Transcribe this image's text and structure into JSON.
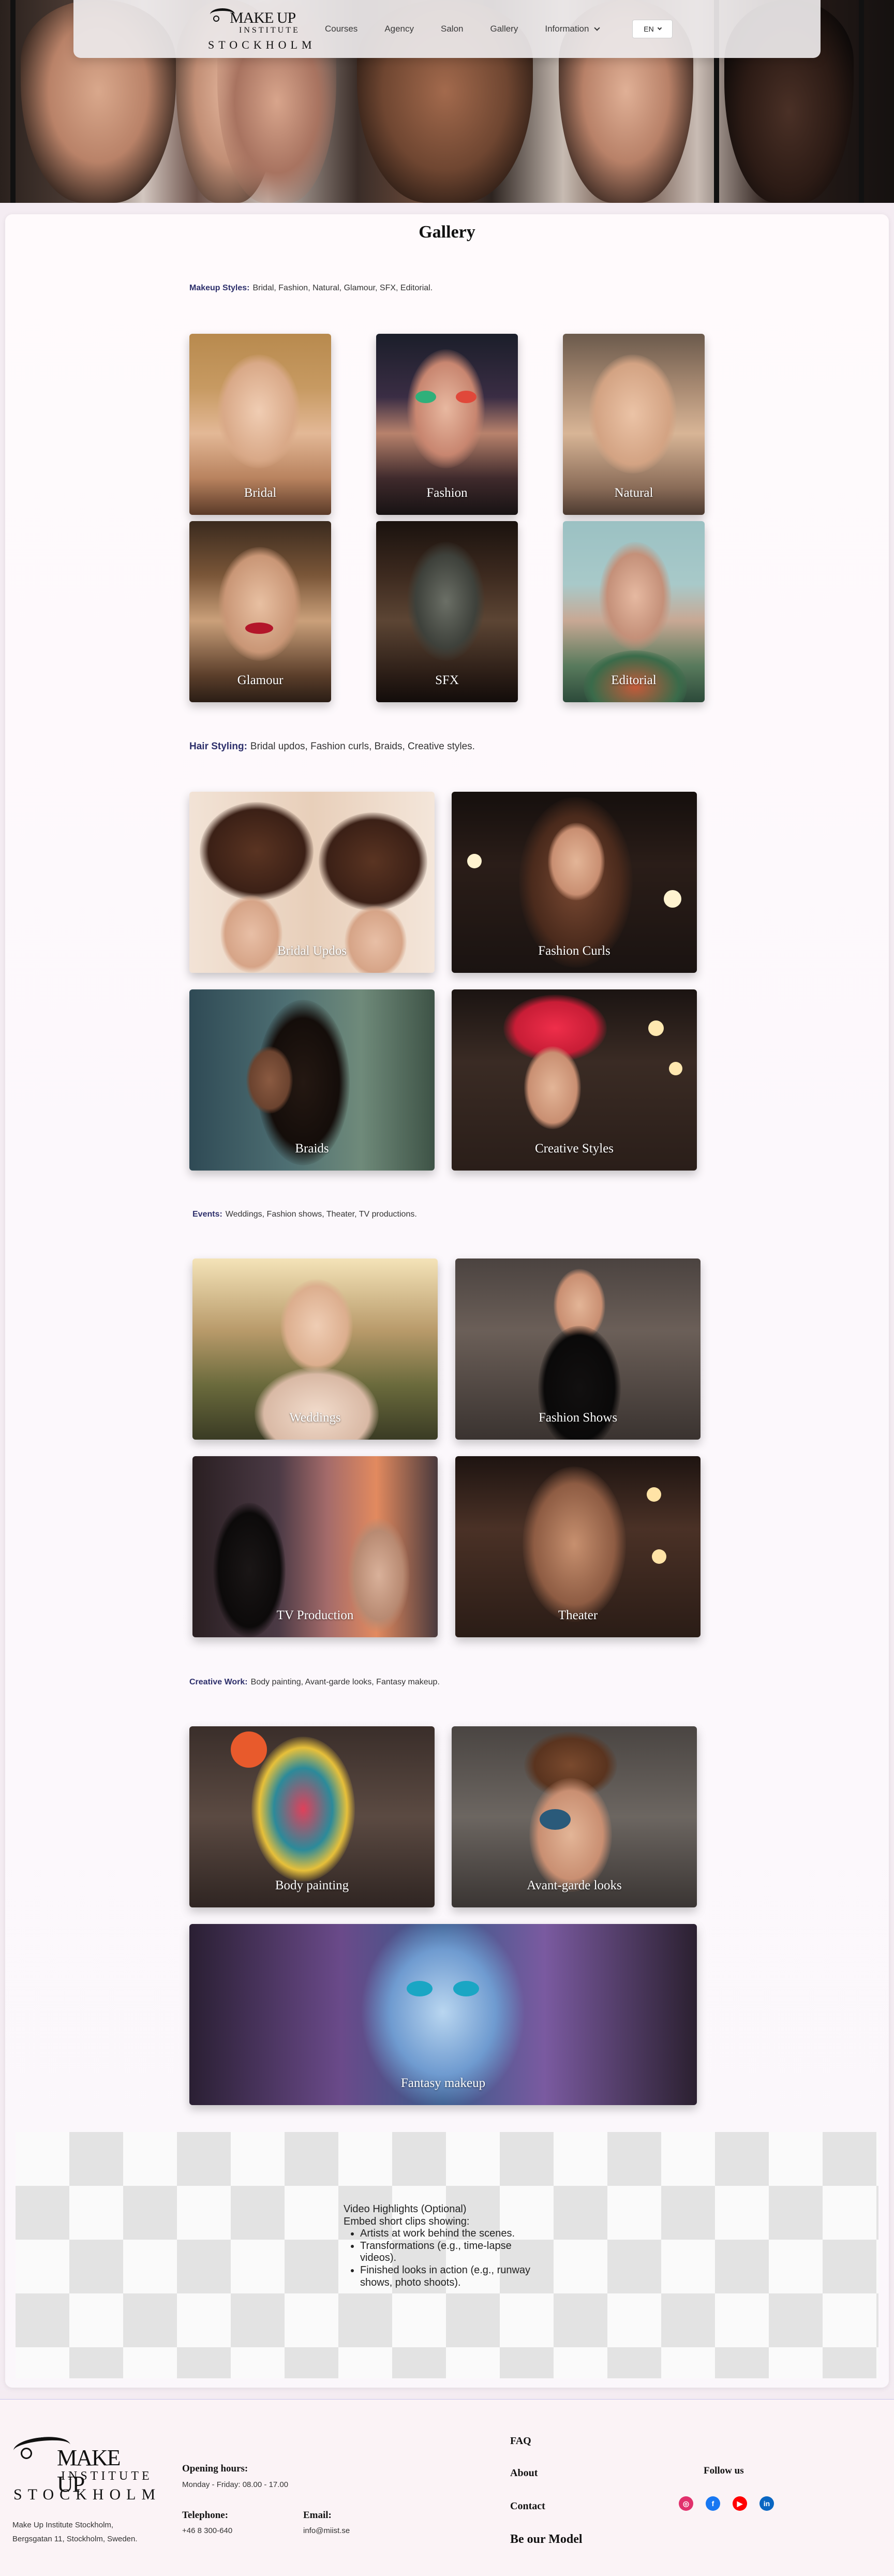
{
  "header": {
    "logo": {
      "line1": "MAKE UP",
      "line2": "INSTITUTE",
      "line3": "STOCKHOLM"
    },
    "menu": [
      {
        "label": "Courses"
      },
      {
        "label": "Agency"
      },
      {
        "label": "Salon"
      },
      {
        "label": "Gallery"
      },
      {
        "label": "Information"
      }
    ],
    "language": "EN"
  },
  "gallery": {
    "title": "Gallery",
    "makeup": {
      "heading": "Makeup Styles:",
      "text": "Bridal, Fashion, Natural, Glamour, SFX, Editorial.",
      "items": [
        "Bridal",
        "Fashion",
        "Natural",
        "Glamour",
        "SFX",
        "Editorial"
      ]
    },
    "hair": {
      "heading": "Hair Styling:",
      "text": "Bridal updos, Fashion curls, Braids, Creative styles.",
      "items": [
        "Bridal Updos",
        "Fashion Curls",
        "Braids",
        "Creative Styles"
      ]
    },
    "events": {
      "heading": "Events:",
      "text": "Weddings, Fashion shows, Theater, TV productions.",
      "items": [
        "Weddings",
        "Fashion Shows",
        "TV Production",
        "Theater"
      ]
    },
    "creative": {
      "heading": "Creative Work:",
      "text": "Body painting, Avant-garde looks, Fantasy makeup.",
      "items": [
        "Body painting",
        "Avant-garde looks",
        "Fantasy makeup"
      ]
    }
  },
  "video": {
    "title": "Video Highlights (Optional)",
    "intro": "Embed short clips showing:",
    "bullets": [
      "Artists at work behind the scenes.",
      "Transformations (e.g., time-lapse videos).",
      "Finished looks in action (e.g., runway shows, photo shoots)."
    ]
  },
  "footer": {
    "logo": {
      "line1": "MAKE UP",
      "line2": "INSTITUTE",
      "line3": "STOCKHOLM"
    },
    "address": [
      "Make Up Institute Stockholm,",
      "Bergsgatan 11, Stockholm, Sweden."
    ],
    "opening_heading": "Opening hours:",
    "opening_value": "Monday - Friday: 08.00 - 17.00",
    "telephone_heading": "Telephone:",
    "telephone_value": "+46 8 300-640",
    "email_heading": "Email:",
    "email_value": "info@miist.se",
    "links": [
      "FAQ",
      "About",
      "Contact",
      "Be our Model"
    ],
    "follow_heading": "Follow us",
    "socials": [
      "instagram-icon",
      "facebook-icon",
      "youtube-icon",
      "linkedin-icon"
    ],
    "social_colors": [
      "#e1306c",
      "#1877f2",
      "#ff0000",
      "#0a66c2"
    ]
  }
}
